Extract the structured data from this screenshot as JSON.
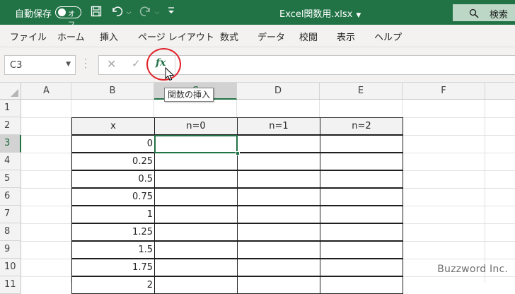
{
  "titlebar": {
    "autosave_label": "自動保存",
    "autosave_state": "オフ",
    "filename": "Excel関数用.xlsx",
    "search_label": "検索",
    "accent_color": "#217346"
  },
  "ribbon_tabs": [
    "ファイル",
    "ホーム",
    "挿入",
    "ページ レイアウト",
    "数式",
    "データ",
    "校閲",
    "表示",
    "ヘルプ"
  ],
  "formula_bar": {
    "name_box": "C3",
    "fx_label": "fx",
    "tooltip": "関数の挿入",
    "value": ""
  },
  "sheet": {
    "columns": [
      "A",
      "B",
      "C",
      "D",
      "E",
      "F"
    ],
    "rows": [
      "1",
      "2",
      "3",
      "4",
      "5",
      "6",
      "7",
      "8",
      "9",
      "10",
      "11"
    ],
    "selected_cell": "C3",
    "table": {
      "headers": [
        "x",
        "n=0",
        "n=1",
        "n=2"
      ],
      "x_values": [
        "0",
        "0.25",
        "0.5",
        "0.75",
        "1",
        "1.25",
        "1.5",
        "1.75",
        "2"
      ]
    }
  },
  "watermark": "Buzzword Inc."
}
